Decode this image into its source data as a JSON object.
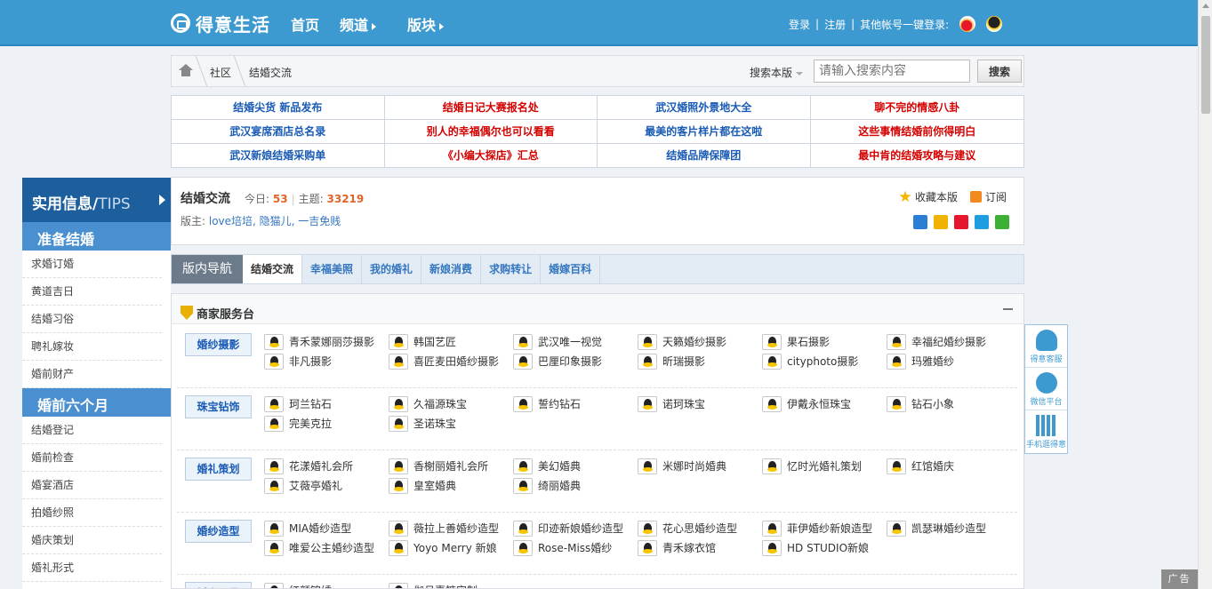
{
  "header": {
    "logo_text": "得意生活",
    "nav": [
      "首页",
      "频道",
      "版块"
    ],
    "login": "登录",
    "register": "注册",
    "other_login": "其他帐号一键登录:"
  },
  "breadcrumb": {
    "items": [
      "社区",
      "结婚交流"
    ],
    "search_scope": "搜索本版",
    "search_placeholder": "请输入搜索内容",
    "search_button": "搜索"
  },
  "promo": [
    {
      "text": "结婚尖货 新品发布",
      "color": "blue"
    },
    {
      "text": "结婚日记大赛报名处",
      "color": "red"
    },
    {
      "text": "武汉婚照外景地大全",
      "color": "blue"
    },
    {
      "text": "聊不完的情感八卦",
      "color": "red"
    },
    {
      "text": "武汉宴席酒店总名录",
      "color": "blue"
    },
    {
      "text": "别人的幸福偶尔也可以看看",
      "color": "red"
    },
    {
      "text": "最美的客片样片都在这啦",
      "color": "blue"
    },
    {
      "text": "这些事情结婚前你得明白",
      "color": "red"
    },
    {
      "text": "武汉新娘结婚采购单",
      "color": "blue"
    },
    {
      "text": "《小编大探店》汇总",
      "color": "red"
    },
    {
      "text": "结婚品牌保障团",
      "color": "blue"
    },
    {
      "text": "最中肯的结婚攻略与建议",
      "color": "red"
    }
  ],
  "sidebar": {
    "title": "实用信息/",
    "title_tip": "TIPS",
    "sections": [
      {
        "label": "准备结婚",
        "items": [
          "求婚订婚",
          "黄道吉日",
          "结婚习俗",
          "聘礼嫁妆",
          "婚前财产"
        ]
      },
      {
        "label": "婚前六个月",
        "items": [
          "结婚登记",
          "婚前检查",
          "婚宴酒店",
          "拍婚纱照",
          "婚庆策划",
          "婚礼形式"
        ]
      }
    ]
  },
  "forum": {
    "title": "结婚交流",
    "today_label": "今日:",
    "today_value": "53",
    "topics_label": "主题:",
    "topics_value": "33219",
    "mods_label": "版主:",
    "mods": "love培培, 隐猫儿, 一吉免贱",
    "favorite": "收藏本版",
    "subscribe": "订阅"
  },
  "tabs": [
    "版内导航",
    "结婚交流",
    "幸福美照",
    "我的婚礼",
    "新娘消费",
    "求购转让",
    "婚嫁百科"
  ],
  "services": {
    "title": "商家服务台",
    "rows": [
      {
        "category": "婚纱摄影",
        "items": [
          "青禾蒙娜丽莎摄影",
          "韩国艺匠",
          "武汉唯一视觉",
          "天籁婚纱摄影",
          "果石摄影",
          "幸福纪婚纱摄影",
          "非凡摄影",
          "喜匠麦田婚纱摄影",
          "巴厘印象摄影",
          "昕瑞摄影",
          "cityphoto摄影",
          "玛雅婚纱"
        ]
      },
      {
        "category": "珠宝钻饰",
        "items": [
          "珂兰钻石",
          "久福源珠宝",
          "誓约钻石",
          "诺珂珠宝",
          "伊戴永恒珠宝",
          "钻石小象",
          "完美克拉",
          "圣诺珠宝"
        ]
      },
      {
        "category": "婚礼策划",
        "items": [
          "花漾婚礼会所",
          "香榭丽婚礼会所",
          "美幻婚典",
          "米娜时尚婚典",
          "忆时光婚礼策划",
          "红馆婚庆",
          "艾薇亭婚礼",
          "皇室婚典",
          "绮丽婚典"
        ]
      },
      {
        "category": "婚纱造型",
        "items": [
          "MIA婚纱造型",
          "薇拉上善婚纱造型",
          "印迹新娘婚纱造型",
          "花心思婚纱造型",
          "菲伊婚纱新娘造型",
          "凯瑟琳婚纱造型",
          "唯爱公主婚纱造型",
          "Yoyo Merry 新娘",
          "Rose-Miss婚纱",
          "青禾嫁衣馆",
          "HD STUDIO新娘"
        ]
      },
      {
        "category": "婚庆用品",
        "items": [
          "红颜锦绣",
          "伽月喜糖定制"
        ]
      }
    ]
  },
  "floatbar": [
    "得意客服",
    "微信平台",
    "手机逛得意"
  ],
  "ad_tag": "广告",
  "colors": {
    "header": "#3d9ad0",
    "sidebar_head": "#1d5e9d",
    "sidebar_section": "#4a8fd0",
    "promo_blue": "#1a5bb5",
    "promo_red": "#d40000",
    "stat_orange": "#e0632a"
  }
}
